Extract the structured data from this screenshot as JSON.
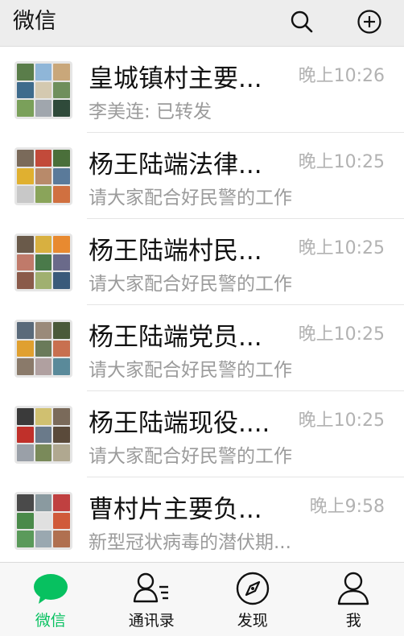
{
  "header": {
    "title": "微信",
    "search_icon": "search-icon",
    "add_icon": "plus-circle-icon"
  },
  "chats": [
    {
      "name": "皇城镇村主要...",
      "time": "晚上10:26",
      "preview": "李美连: 已转发"
    },
    {
      "name": "杨王陆端法律...",
      "time": "晚上10:25",
      "preview": "请大家配合好民警的工作"
    },
    {
      "name": "杨王陆端村民...",
      "time": "晚上10:25",
      "preview": "请大家配合好民警的工作"
    },
    {
      "name": "杨王陆端党员...",
      "time": "晚上10:25",
      "preview": "请大家配合好民警的工作"
    },
    {
      "name": "杨王陆端现役....",
      "time": "晚上10:25",
      "preview": "请大家配合好民警的工作"
    },
    {
      "name": "曹村片主要负...",
      "time": "晚上9:58",
      "preview": "新型冠状病毒的潜伏期..."
    }
  ],
  "tabbar": {
    "tabs": [
      {
        "label": "微信",
        "icon": "chat-bubble-icon",
        "active": true
      },
      {
        "label": "通讯录",
        "icon": "contacts-icon",
        "active": false
      },
      {
        "label": "发现",
        "icon": "compass-icon",
        "active": false
      },
      {
        "label": "我",
        "icon": "person-icon",
        "active": false
      }
    ]
  },
  "colors": {
    "accent": "#07c160",
    "header_bg": "#ededed",
    "tabbar_bg": "#f7f7f7",
    "secondary_text": "#9b9b9b",
    "time_text": "#b2b2b2"
  }
}
